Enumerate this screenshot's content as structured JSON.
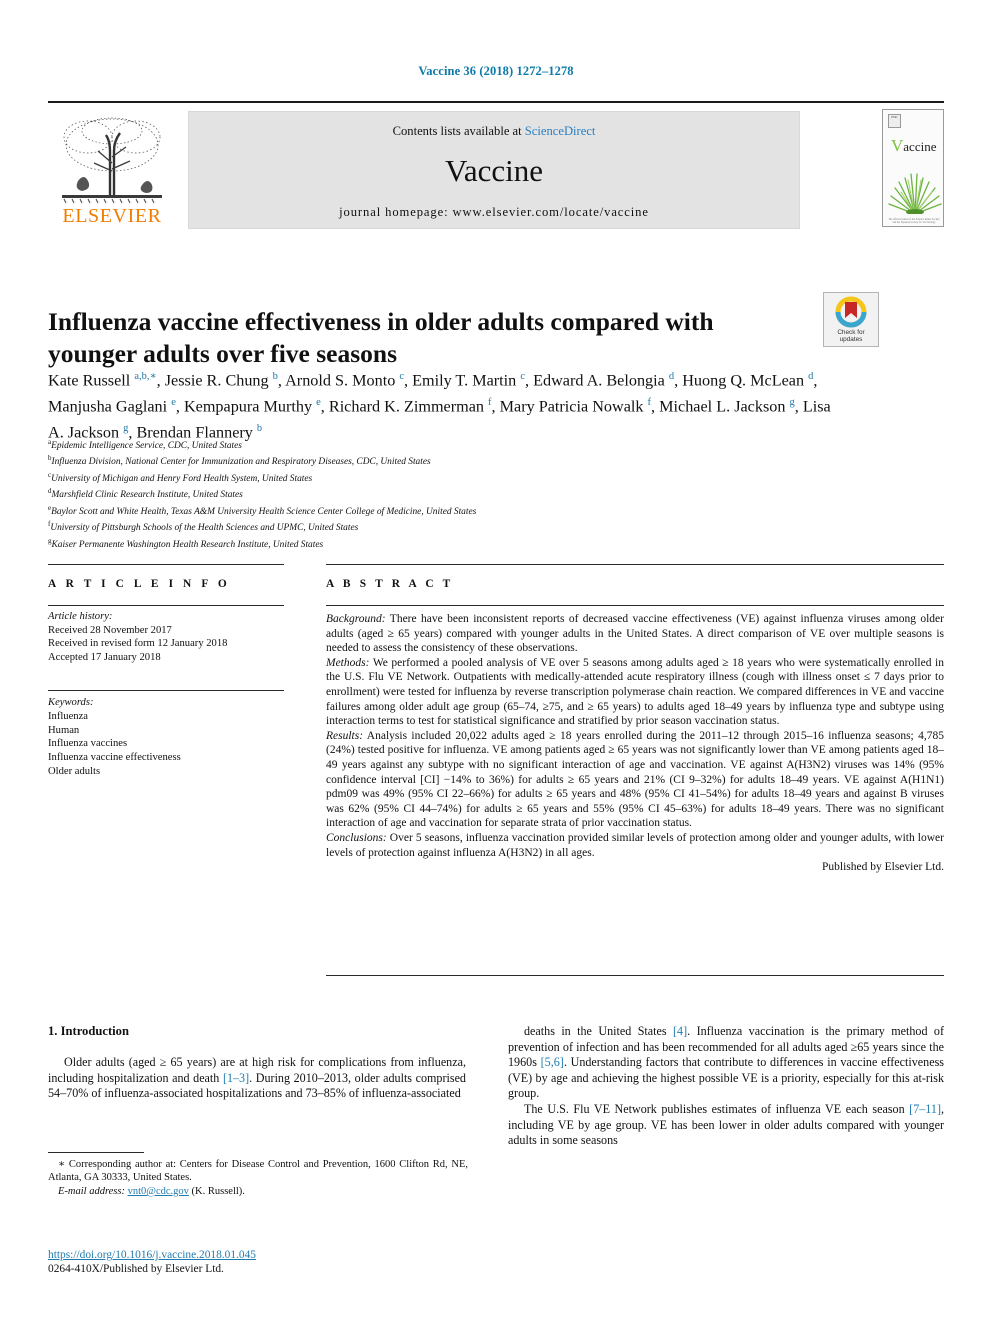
{
  "running_head": "Vaccine 36 (2018) 1272–1278",
  "masthead": {
    "publisher_logo_text": "ELSEVIER",
    "contents_prefix": "Contents lists available at ",
    "contents_link": "ScienceDirect",
    "journal_name": "Vaccine",
    "homepage": "journal homepage: www.elsevier.com/locate/vaccine",
    "cover_badge": "PMC",
    "cover_title_initial": "V",
    "cover_title_rest": "accine",
    "cover_footer": "The official journal of the Edward Jenner Society and the Japanese Society for Vaccinology"
  },
  "crossmark": {
    "line1": "Check for",
    "line2": "updates"
  },
  "article": {
    "title": "Influenza vaccine effectiveness in older adults compared with younger adults over five seasons",
    "authors_html": "Kate Russell <sup>a,b,∗</sup>, Jessie R. Chung <sup>b</sup>, Arnold S. Monto <sup>c</sup>, Emily T. Martin <sup>c</sup>, Edward A. Belongia <sup>d</sup>, Huong Q. McLean <sup>d</sup>, Manjusha Gaglani <sup>e</sup>, Kempapura Murthy <sup>e</sup>, Richard K. Zimmerman <sup>f</sup>, Mary Patricia Nowalk <sup>f</sup>, Michael L. Jackson <sup>g</sup>, Lisa A. Jackson <sup>g</sup>, Brendan Flannery <sup>b</sup>",
    "affiliations": [
      {
        "mark": "a",
        "text": "Epidemic Intelligence Service, CDC, United States"
      },
      {
        "mark": "b",
        "text": "Influenza Division, National Center for Immunization and Respiratory Diseases, CDC, United States"
      },
      {
        "mark": "c",
        "text": "University of Michigan and Henry Ford Health System, United States"
      },
      {
        "mark": "d",
        "text": "Marshfield Clinic Research Institute, United States"
      },
      {
        "mark": "e",
        "text": "Baylor Scott and White Health, Texas A&M University Health Science Center College of Medicine, United States"
      },
      {
        "mark": "f",
        "text": "University of Pittsburgh Schools of the Health Sciences and UPMC, United States"
      },
      {
        "mark": "g",
        "text": "Kaiser Permanente Washington Health Research Institute, United States"
      }
    ]
  },
  "article_info": {
    "heading": "A R T I C L E   I N F O",
    "history_label": "Article history:",
    "history": [
      "Received 28 November 2017",
      "Received in revised form 12 January 2018",
      "Accepted 17 January 2018"
    ],
    "keywords_label": "Keywords:",
    "keywords": [
      "Influenza",
      "Human",
      "Influenza vaccines",
      "Influenza vaccine effectiveness",
      "Older adults"
    ]
  },
  "abstract": {
    "heading": "A B S T R A C T",
    "background_label": "Background:",
    "background": " There have been inconsistent reports of decreased vaccine effectiveness (VE) against influenza viruses among older adults (aged ≥ 65 years) compared with younger adults in the United States. A direct comparison of VE over multiple seasons is needed to assess the consistency of these observations.",
    "methods_label": "Methods:",
    "methods": " We performed a pooled analysis of VE over 5 seasons among adults aged ≥ 18 years who were systematically enrolled in the U.S. Flu VE Network. Outpatients with medically-attended acute respiratory illness (cough with illness onset ≤ 7 days prior to enrollment) were tested for influenza by reverse transcription polymerase chain reaction. We compared differences in VE and vaccine failures among older adult age group (65–74, ≥75, and ≥ 65 years) to adults aged 18–49 years by influenza type and subtype using interaction terms to test for statistical significance and stratified by prior season vaccination status.",
    "results_label": "Results:",
    "results": " Analysis included 20,022 adults aged ≥ 18 years enrolled during the 2011–12 through 2015–16 influenza seasons; 4,785 (24%) tested positive for influenza. VE among patients aged ≥ 65 years was not significantly lower than VE among patients aged 18–49 years against any subtype with no significant interaction of age and vaccination. VE against A(H3N2) viruses was 14% (95% confidence interval [CI] −14% to 36%) for adults ≥ 65 years and 21% (CI 9–32%) for adults 18–49 years. VE against A(H1N1) pdm09 was 49% (95% CI 22–66%) for adults ≥ 65 years and 48% (95% CI 41–54%) for adults 18–49 years and against B viruses was 62% (95% CI 44–74%) for adults ≥ 65 years and 55% (95% CI 45–63%) for adults 18–49 years. There was no significant interaction of age and vaccination for separate strata of prior vaccination status.",
    "conclusions_label": "Conclusions:",
    "conclusions": " Over 5 seasons, influenza vaccination provided similar levels of protection among older and younger adults, with lower levels of protection against influenza A(H3N2) in all ages.",
    "published_by": "Published by Elsevier Ltd."
  },
  "body": {
    "section_number_title": "1. Introduction",
    "left_paragraph_html": "Older adults (aged ≥ 65 years) are at high risk for complications from influenza, including hospitalization and death <span class=\"ref\">[1–3]</span>. During 2010–2013, older adults comprised 54–70% of influenza-associated hospitalizations and 73–85% of influenza-associated",
    "right_paragraph_1_html": "deaths in the United States <span class=\"ref\">[4]</span>. Influenza vaccination is the primary method of prevention of infection and has been recommended for all adults aged ≥65 years since the 1960s <span class=\"ref\">[5,6]</span>. Understanding factors that contribute to differences in vaccine effectiveness (VE) by age and achieving the highest possible VE is a priority, especially for this at-risk group.",
    "right_paragraph_2_html": "The U.S. Flu VE Network publishes estimates of influenza VE each season <span class=\"ref\">[7–11]</span>, including VE by age group. VE has been lower in older adults compared with younger adults in some seasons"
  },
  "footnote": {
    "corresponding_html": "∗ Corresponding author at: Centers for Disease Control and Prevention, 1600 Clifton Rd, NE, Atlanta, GA 30333, United States.",
    "email_label": "E-mail address:",
    "email": "vnt0@cdc.gov",
    "email_owner": "(K. Russell)."
  },
  "identifiers": {
    "doi": "https://doi.org/10.1016/j.vaccine.2018.01.045",
    "issn_line": "0264-410X/Published by Elsevier Ltd."
  },
  "colors": {
    "link_blue": "#1f7bb0",
    "runhead_blue": "#0c7aa8",
    "elsevier_orange": "#f07d00",
    "masthead_grey": "#e3e3e3",
    "cover_green": "#7bbf3a"
  }
}
